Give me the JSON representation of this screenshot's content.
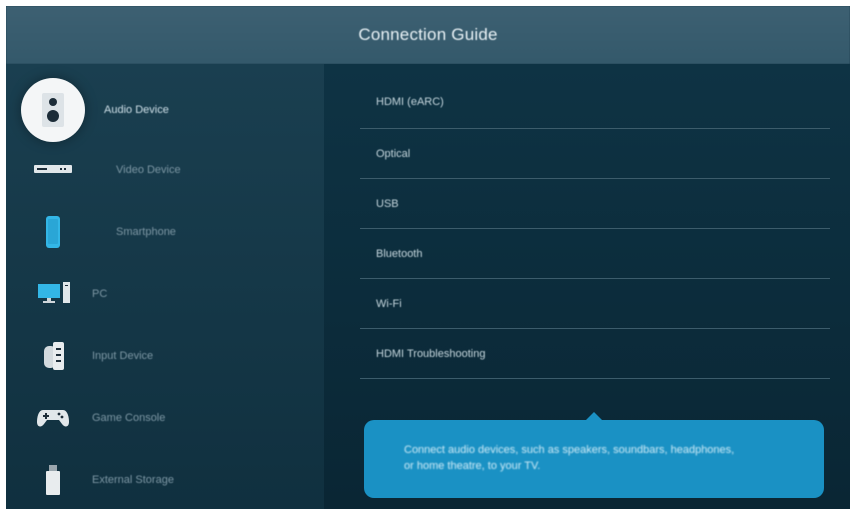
{
  "header": {
    "title": "Connection Guide"
  },
  "sidebar": {
    "items": [
      {
        "label": "Audio Device",
        "icon": "speaker-icon",
        "active": true
      },
      {
        "label": "Video Device",
        "icon": "video-player-icon",
        "active": false
      },
      {
        "label": "Smartphone",
        "icon": "smartphone-icon",
        "active": false
      },
      {
        "label": "PC",
        "icon": "pc-icon",
        "active": false
      },
      {
        "label": "Input Device",
        "icon": "input-device-icon",
        "active": false
      },
      {
        "label": "Game Console",
        "icon": "gamepad-icon",
        "active": false
      },
      {
        "label": "External Storage",
        "icon": "usb-storage-icon",
        "active": false
      }
    ]
  },
  "main": {
    "options": [
      {
        "label": "HDMI (eARC)"
      },
      {
        "label": "Optical"
      },
      {
        "label": "USB"
      },
      {
        "label": "Bluetooth"
      },
      {
        "label": "Wi-Fi"
      },
      {
        "label": "HDMI Troubleshooting"
      }
    ],
    "tooltip": {
      "line1": "Connect audio devices, such as speakers, soundbars, headphones,",
      "line2": "or home theatre, to your TV."
    }
  },
  "colors": {
    "header_bg": "#3d6072",
    "sidebar_bg": "#1a3f50",
    "main_bg": "#0e3344",
    "tooltip_bg": "#1a91c4",
    "icon_accent": "#33b6e6"
  }
}
